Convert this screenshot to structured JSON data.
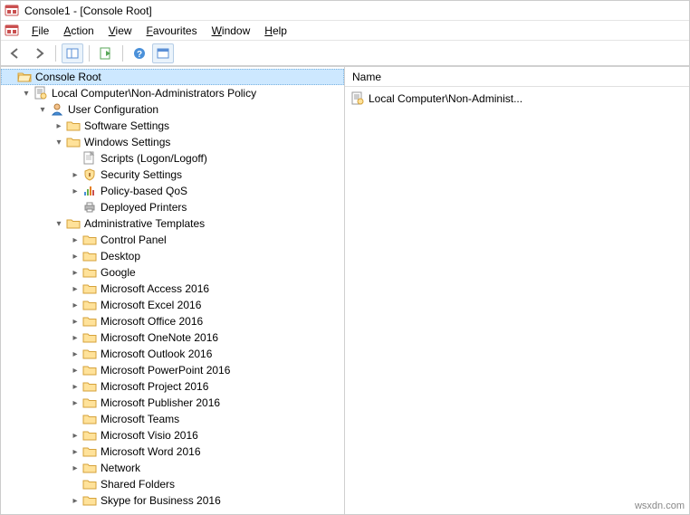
{
  "title": "Console1 - [Console Root]",
  "menu": [
    "File",
    "Action",
    "View",
    "Favourites",
    "Window",
    "Help"
  ],
  "list": {
    "header": "Name",
    "items": [
      "Local Computer\\Non-Administ..."
    ]
  },
  "watermark": "wsxdn.com",
  "icons": {
    "mmc": "mmc-icon",
    "folder": "folder-icon",
    "folder_open": "folder-open-icon",
    "policy": "policy-icon",
    "user": "user-icon",
    "script": "script-icon",
    "shield": "shield-icon",
    "qos": "qos-icon",
    "printer": "printer-icon"
  },
  "tree": {
    "root": {
      "label": "Console Root",
      "selected": true,
      "children": [
        {
          "label": "Local Computer\\Non-Administrators Policy",
          "icon": "policy",
          "expand": "open",
          "children": [
            {
              "label": "User Configuration",
              "icon": "user",
              "expand": "open",
              "children": [
                {
                  "label": "Software Settings",
                  "icon": "folder",
                  "expand": "closed"
                },
                {
                  "label": "Windows Settings",
                  "icon": "folder",
                  "expand": "open",
                  "children": [
                    {
                      "label": "Scripts (Logon/Logoff)",
                      "icon": "script",
                      "expand": "none"
                    },
                    {
                      "label": "Security Settings",
                      "icon": "shield",
                      "expand": "closed"
                    },
                    {
                      "label": "Policy-based QoS",
                      "icon": "qos",
                      "expand": "closed"
                    },
                    {
                      "label": "Deployed Printers",
                      "icon": "printer",
                      "expand": "none"
                    }
                  ]
                },
                {
                  "label": "Administrative Templates",
                  "icon": "folder",
                  "expand": "open",
                  "children": [
                    {
                      "label": "Control Panel",
                      "icon": "folder",
                      "expand": "closed"
                    },
                    {
                      "label": "Desktop",
                      "icon": "folder",
                      "expand": "closed"
                    },
                    {
                      "label": "Google",
                      "icon": "folder",
                      "expand": "closed"
                    },
                    {
                      "label": "Microsoft Access 2016",
                      "icon": "folder",
                      "expand": "closed"
                    },
                    {
                      "label": "Microsoft Excel 2016",
                      "icon": "folder",
                      "expand": "closed"
                    },
                    {
                      "label": "Microsoft Office 2016",
                      "icon": "folder",
                      "expand": "closed"
                    },
                    {
                      "label": "Microsoft OneNote 2016",
                      "icon": "folder",
                      "expand": "closed"
                    },
                    {
                      "label": "Microsoft Outlook 2016",
                      "icon": "folder",
                      "expand": "closed"
                    },
                    {
                      "label": "Microsoft PowerPoint 2016",
                      "icon": "folder",
                      "expand": "closed"
                    },
                    {
                      "label": "Microsoft Project 2016",
                      "icon": "folder",
                      "expand": "closed"
                    },
                    {
                      "label": "Microsoft Publisher 2016",
                      "icon": "folder",
                      "expand": "closed"
                    },
                    {
                      "label": "Microsoft Teams",
                      "icon": "folder",
                      "expand": "none"
                    },
                    {
                      "label": "Microsoft Visio 2016",
                      "icon": "folder",
                      "expand": "closed"
                    },
                    {
                      "label": "Microsoft Word 2016",
                      "icon": "folder",
                      "expand": "closed"
                    },
                    {
                      "label": "Network",
                      "icon": "folder",
                      "expand": "closed"
                    },
                    {
                      "label": "Shared Folders",
                      "icon": "folder",
                      "expand": "none"
                    },
                    {
                      "label": "Skype for Business 2016",
                      "icon": "folder",
                      "expand": "closed"
                    }
                  ]
                }
              ]
            }
          ]
        }
      ]
    }
  }
}
